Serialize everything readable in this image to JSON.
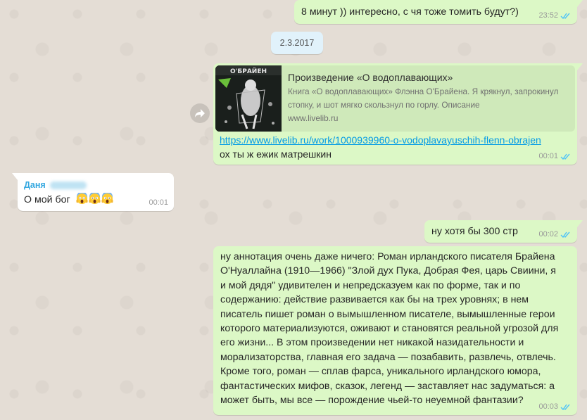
{
  "chat": {
    "messages": [
      {
        "direction": "out",
        "text": "8 минут )) интересно, с чя тоже томить будут?)",
        "time": "23:52",
        "status": "read"
      },
      {
        "type": "date-divider",
        "text": "2.3.2017"
      },
      {
        "direction": "out",
        "preview": {
          "title": "Произведение «О водоплавающих»",
          "description": "Книга «О водоплавающих» Флэнна О'Брайена. Я крякнул, запрокинул стопку, и шот мягко скользнул по горлу. Описание",
          "domain": "www.livelib.ru",
          "thumb_label": "О'БРАЙЕН"
        },
        "link": "https://www.livelib.ru/work/1000939960-o-vodoplavayuschih-flenn-obrajen",
        "text": "ох ты ж ежик матрешкин",
        "time": "00:01",
        "status": "read"
      },
      {
        "direction": "in",
        "sender": "Даня",
        "text": "О мой бог",
        "emoji": [
          "😱",
          "😱",
          "😱"
        ],
        "time": "00:01"
      },
      {
        "direction": "out",
        "text": "ну хотя бы 300 стр",
        "time": "00:02",
        "status": "read"
      },
      {
        "direction": "out",
        "text": "ну аннотация очень даже ничего: Роман ирландского писателя Брайена О'Нуаллайна (1910—1966) \"Злой дух Пука, Добрая Фея, царь Свиини, я и мой дядя\" удивителен и непредсказуем как по форме, так и по содержанию: действие развивается как бы на трех уровнях; в нем писатель пишет роман о вымышленном писателе, вымышленные герои которого материализуются, оживают и становятся реальной угрозой для его жизни... В этом произведении нет никакой назидательности и морализаторства, главная его задача — позабавить, развлечь, отвлечь. Кроме того, роман — сплав фарса, уникального ирландского юмора, фантастических мифов, сказок, легенд — заставляет нас задуматься: а может быть, мы все — порождение чьей-то неуемной фантазии?",
        "time": "00:03",
        "status": "read"
      }
    ]
  },
  "colors": {
    "outgoing_bubble": "#dcf8c6",
    "incoming_bubble": "#ffffff",
    "background": "#e4ddd5",
    "link": "#039be5",
    "sender_name": "#35a8e0",
    "read_ticks": "#4fc3f7"
  },
  "icons": {
    "forward": "forward-arrow-icon",
    "read_status": "double-check-icon"
  }
}
